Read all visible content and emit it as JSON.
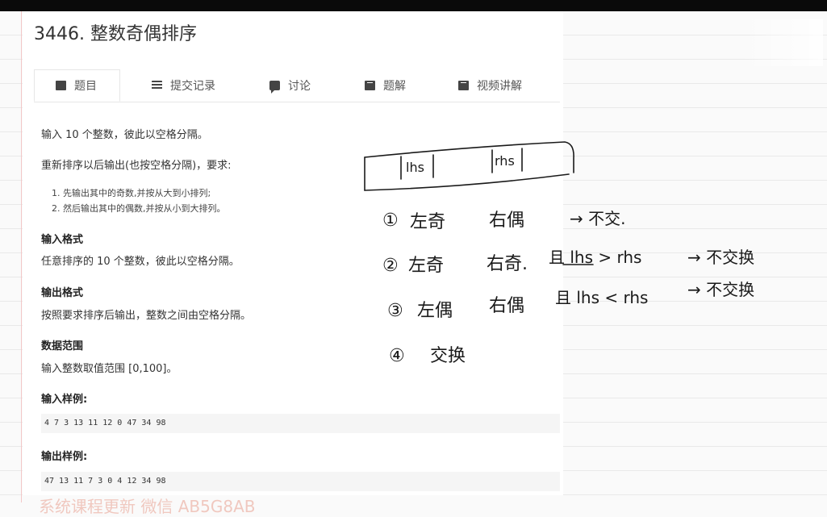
{
  "problem": {
    "title": "3446. 整数奇偶排序"
  },
  "tabs": [
    {
      "label": "题目",
      "icon": "document-icon"
    },
    {
      "label": "提交记录",
      "icon": "list-icon"
    },
    {
      "label": "讨论",
      "icon": "chat-icon"
    },
    {
      "label": "题解",
      "icon": "book-icon"
    },
    {
      "label": "视频讲解",
      "icon": "video-icon"
    }
  ],
  "content": {
    "intro": "输入 10 个整数，彼此以空格分隔。",
    "requirement": "重新排序以后输出(也按空格分隔)，要求:",
    "rules": [
      "1. 先输出其中的奇数,并按从大到小排列;",
      "2. 然后输出其中的偶数,并按从小到大排列。"
    ],
    "input_format_heading": "输入格式",
    "input_format": "任意排序的 10 个整数，彼此以空格分隔。",
    "output_format_heading": "输出格式",
    "output_format": "按照要求排序后输出，整数之间由空格分隔。",
    "range_heading": "数据范围",
    "range": "输入整数取值范围 [0,100]。",
    "sample_input_heading": "输入样例:",
    "sample_input": "4 7 3 13 11 12 0 47 34 98",
    "sample_output_heading": "输出样例:",
    "sample_output": "47 13 11 7 3 0 4 12 34 98"
  },
  "handwriting": {
    "box_labels": [
      "lhs",
      "rhs"
    ],
    "cases": [
      {
        "num": "①",
        "left": "左奇",
        "right": "右偶",
        "cond": "",
        "result": "→ 不交."
      },
      {
        "num": "②",
        "left": "左奇",
        "right": "右奇.",
        "cond": "且 lhs > rhs",
        "result": "→ 不交换"
      },
      {
        "num": "③",
        "left": "左偶",
        "right": "右偶",
        "cond": "且 lhs < rhs",
        "result": "→ 不交换"
      },
      {
        "num": "④",
        "left": "交换",
        "right": "",
        "cond": "",
        "result": ""
      }
    ]
  },
  "footer": {
    "promo": "系统课程更新 微信 AB5G8AB"
  },
  "colors": {
    "ink": "#1a1a1a",
    "active_tab_bg": "#ffffff",
    "code_bg": "#f5f5f5",
    "promo": "#e8a090"
  }
}
